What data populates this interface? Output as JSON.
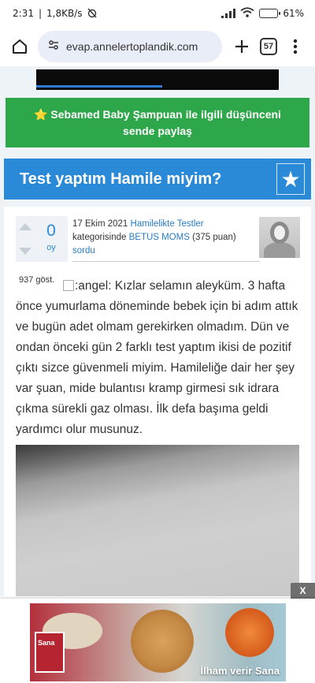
{
  "status_bar": {
    "time": "2:31",
    "net_speed": "1,8KB/s",
    "battery": "61",
    "battery_level": 0.61
  },
  "browser": {
    "url": "evap.annelertoplandik.com",
    "tab_count": "57"
  },
  "banner": {
    "text": "⭐ Sebamed Baby Şampuan ile ilgili düşünceni sende paylaş"
  },
  "question": {
    "title": "Test yaptım Hamile miyim?",
    "votes": "0",
    "votes_label": "oy",
    "date": "17 Ekim 2021",
    "category": "Hamilelikte Testler",
    "category_suffix": "kategorisinde",
    "author": "BETUS MOMS",
    "points": "(375 puan)",
    "action": "sordu",
    "views": "937 göst.",
    "emoji_alt": ":angel:",
    "body": "Kızlar selamın aleyküm. 3 hafta önce yumurlama döneminde bebek için bi adım attık ve bugün adet olmam gerekirken olmadım. Dün ve ondan önceki gün 2 farklı test yaptım ikisi de pozitif çıktı sizce güvenmeli miyim. Hamileliğe dair her şey var şuan, mide bulantısı kramp girmesi sık idrara çıkma sürekli gaz olması. İlk defa başıma geldi yardımcı olur musunuz."
  },
  "ad": {
    "close_label": "X",
    "brand": "Sana",
    "slogan": "İlham verir Sana"
  },
  "colors": {
    "banner_green": "#2ea64a",
    "title_blue": "#2b8ad8",
    "link_blue": "#2b7bc0"
  }
}
